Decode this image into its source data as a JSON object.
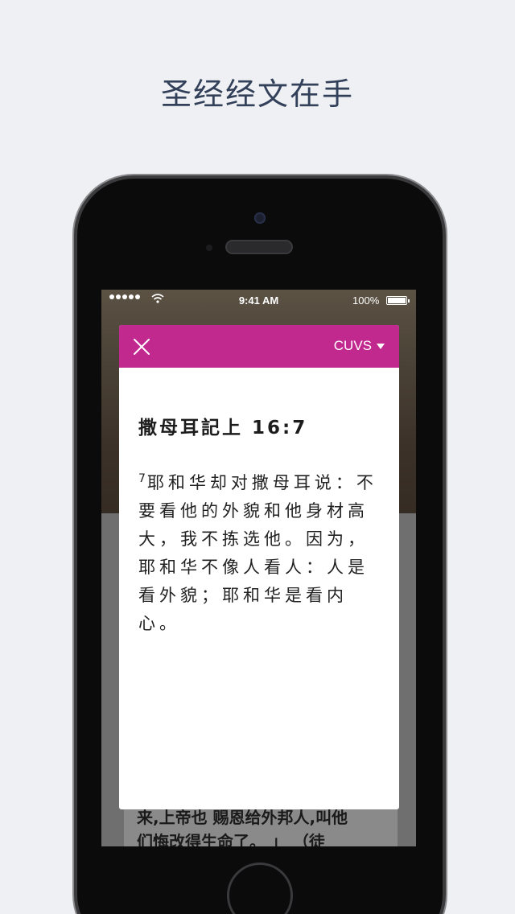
{
  "headline": "圣经经文在手",
  "status_bar": {
    "time": "9:41 AM",
    "battery": "100%"
  },
  "modal": {
    "version": "CUVS",
    "reference": "撒母耳記上 16:7",
    "verse_number": "7",
    "verse_text": "耶和华却对撒母耳说：不要看他的外貌和他身材高大，我不拣选他。因为，耶和华不像人看人：人是看外貌；耶和华是看内心。"
  },
  "background_text": {
    "line1": "来,上帝也 赐恩给外邦人,叫他",
    "line2": "们悔改得生命了。 」 （徒"
  },
  "colors": {
    "page_bg": "#eef0f3",
    "headline": "#33405a",
    "modal_header": "#c1298f"
  },
  "icons": [
    "close-icon",
    "caret-down-icon",
    "wifi-icon",
    "battery-icon"
  ]
}
